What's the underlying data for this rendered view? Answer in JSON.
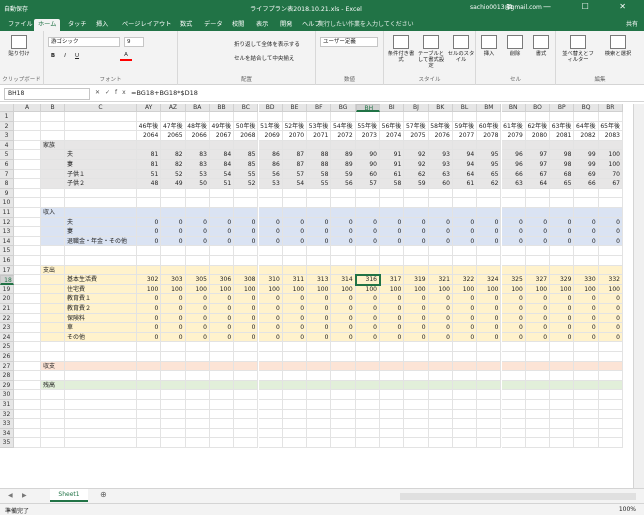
{
  "titlebar": {
    "autosave": "自動保存",
    "title": "ライフプラン表2018.10.21.xls  -  Excel",
    "user": "sachio0013@gmail.com",
    "window_controls": "⧉ — ☐ ✕"
  },
  "tabs": [
    "ファイル",
    "ホーム",
    "タッチ",
    "挿入",
    "ページレイアウト",
    "数式",
    "データ",
    "校閲",
    "表示",
    "開発",
    "ヘルプ"
  ],
  "tell_me": "実行したい作業を入力してください",
  "share": "共有",
  "ribbon": {
    "groups": {
      "clipboard": "クリップボード",
      "font": "フォント",
      "alignment": "配置",
      "number": "数値",
      "styles": "スタイル",
      "cells": "セル",
      "editing": "編集"
    },
    "paste": "貼り付け",
    "font_name": "游ゴシック",
    "font_size": "9",
    "number_format": "ユーザー定義",
    "wrap_text": "折り返して全体を表示する",
    "merge_center": "セルを結合して中央揃え",
    "cond_format": "条件付き書式",
    "table_format": "テーブルとして書式設定",
    "cell_style": "セルのスタイル",
    "insert": "挿入",
    "delete": "削除",
    "format": "書式",
    "sort_filter": "並べ替えとフィルター",
    "find_select": "検索と選択"
  },
  "formula_bar": {
    "name_box": "BH18",
    "formula": "=BG18+BG18*$D18"
  },
  "columns": [
    "A",
    "B",
    "C",
    "AY",
    "AZ",
    "BA",
    "BB",
    "BC",
    "BD",
    "BE",
    "BF",
    "BG",
    "BH",
    "BI",
    "BJ",
    "BK",
    "BL",
    "BM",
    "BN",
    "BO",
    "BP",
    "BQ",
    "BR"
  ],
  "selected_column": "BH",
  "selected_row": 18,
  "rows": [
    {
      "n": 1,
      "c": "",
      "d": []
    },
    {
      "n": 2,
      "c": "",
      "d": [
        "46年後",
        "47年後",
        "48年後",
        "49年後",
        "50年後",
        "51年後",
        "52年後",
        "53年後",
        "54年後",
        "55年後",
        "56年後",
        "57年後",
        "58年後",
        "59年後",
        "60年後",
        "61年後",
        "62年後",
        "63年後",
        "64年後",
        "65年後"
      ]
    },
    {
      "n": 3,
      "c": "",
      "d": [
        "2064",
        "2065",
        "2066",
        "2067",
        "2068",
        "2069",
        "2070",
        "2071",
        "2072",
        "2073",
        "2074",
        "2075",
        "2076",
        "2077",
        "2078",
        "2079",
        "2080",
        "2081",
        "2082",
        "2083"
      ]
    },
    {
      "n": 4,
      "b": "家族",
      "c": "",
      "d": []
    },
    {
      "n": 5,
      "c": "夫",
      "d": [
        "81",
        "82",
        "83",
        "84",
        "85",
        "86",
        "87",
        "88",
        "89",
        "90",
        "91",
        "92",
        "93",
        "94",
        "95",
        "96",
        "97",
        "98",
        "99",
        "100"
      ]
    },
    {
      "n": 6,
      "c": "妻",
      "d": [
        "81",
        "82",
        "83",
        "84",
        "85",
        "86",
        "87",
        "88",
        "89",
        "90",
        "91",
        "92",
        "93",
        "94",
        "95",
        "96",
        "97",
        "98",
        "99",
        "100"
      ]
    },
    {
      "n": 7,
      "c": "子供１",
      "d": [
        "51",
        "52",
        "53",
        "54",
        "55",
        "56",
        "57",
        "58",
        "59",
        "60",
        "61",
        "62",
        "63",
        "64",
        "65",
        "66",
        "67",
        "68",
        "69",
        "70"
      ]
    },
    {
      "n": 8,
      "c": "子供２",
      "d": [
        "48",
        "49",
        "50",
        "51",
        "52",
        "53",
        "54",
        "55",
        "56",
        "57",
        "58",
        "59",
        "60",
        "61",
        "62",
        "63",
        "64",
        "65",
        "66",
        "67"
      ]
    },
    {
      "n": 9,
      "c": "",
      "d": []
    },
    {
      "n": 10,
      "c": "",
      "d": []
    },
    {
      "n": 11,
      "b": "収入",
      "c": "",
      "d": []
    },
    {
      "n": 12,
      "c": "夫",
      "d": [
        "0",
        "0",
        "0",
        "0",
        "0",
        "0",
        "0",
        "0",
        "0",
        "0",
        "0",
        "0",
        "0",
        "0",
        "0",
        "0",
        "0",
        "0",
        "0",
        "0"
      ]
    },
    {
      "n": 13,
      "c": "妻",
      "d": [
        "0",
        "0",
        "0",
        "0",
        "0",
        "0",
        "0",
        "0",
        "0",
        "0",
        "0",
        "0",
        "0",
        "0",
        "0",
        "0",
        "0",
        "0",
        "0",
        "0"
      ]
    },
    {
      "n": 14,
      "c": "退職金・年金・その他",
      "d": [
        "0",
        "0",
        "0",
        "0",
        "0",
        "0",
        "0",
        "0",
        "0",
        "0",
        "0",
        "0",
        "0",
        "0",
        "0",
        "0",
        "0",
        "0",
        "0",
        "0"
      ]
    },
    {
      "n": 15,
      "c": "",
      "d": []
    },
    {
      "n": 16,
      "c": "",
      "d": []
    },
    {
      "n": 17,
      "b": "支出",
      "c": "",
      "d": []
    },
    {
      "n": 18,
      "c": "基本生活費",
      "d": [
        "302",
        "303",
        "305",
        "306",
        "308",
        "310",
        "311",
        "313",
        "314",
        "316",
        "317",
        "319",
        "321",
        "322",
        "324",
        "325",
        "327",
        "329",
        "330",
        "332"
      ]
    },
    {
      "n": 19,
      "c": "住宅費",
      "d": [
        "100",
        "100",
        "100",
        "100",
        "100",
        "100",
        "100",
        "100",
        "100",
        "100",
        "100",
        "100",
        "100",
        "100",
        "100",
        "100",
        "100",
        "100",
        "100",
        "100"
      ]
    },
    {
      "n": 20,
      "c": "教育費１",
      "d": [
        "0",
        "0",
        "0",
        "0",
        "0",
        "0",
        "0",
        "0",
        "0",
        "0",
        "0",
        "0",
        "0",
        "0",
        "0",
        "0",
        "0",
        "0",
        "0",
        "0"
      ]
    },
    {
      "n": 21,
      "c": "教育費２",
      "d": [
        "0",
        "0",
        "0",
        "0",
        "0",
        "0",
        "0",
        "0",
        "0",
        "0",
        "0",
        "0",
        "0",
        "0",
        "0",
        "0",
        "0",
        "0",
        "0",
        "0"
      ]
    },
    {
      "n": 22,
      "c": "保険料",
      "d": [
        "0",
        "0",
        "0",
        "0",
        "0",
        "0",
        "0",
        "0",
        "0",
        "0",
        "0",
        "0",
        "0",
        "0",
        "0",
        "0",
        "0",
        "0",
        "0",
        "0"
      ]
    },
    {
      "n": 23,
      "c": "車",
      "d": [
        "0",
        "0",
        "0",
        "0",
        "0",
        "0",
        "0",
        "0",
        "0",
        "0",
        "0",
        "0",
        "0",
        "0",
        "0",
        "0",
        "0",
        "0",
        "0",
        "0"
      ]
    },
    {
      "n": 24,
      "c": "その他",
      "d": [
        "0",
        "0",
        "0",
        "0",
        "0",
        "0",
        "0",
        "0",
        "0",
        "0",
        "0",
        "0",
        "0",
        "0",
        "0",
        "0",
        "0",
        "0",
        "0",
        "0"
      ]
    },
    {
      "n": 25,
      "c": "",
      "d": []
    },
    {
      "n": 26,
      "c": "",
      "d": []
    },
    {
      "n": 27,
      "b": "収支",
      "c": "",
      "d": []
    },
    {
      "n": 28,
      "c": "",
      "d": []
    },
    {
      "n": 29,
      "b": "残高",
      "c": "",
      "d": []
    },
    {
      "n": 30,
      "c": "",
      "d": []
    },
    {
      "n": 31,
      "c": "",
      "d": []
    },
    {
      "n": 32,
      "c": "",
      "d": []
    },
    {
      "n": 33,
      "c": "",
      "d": []
    },
    {
      "n": 34,
      "c": "",
      "d": []
    },
    {
      "n": 35,
      "c": "",
      "d": []
    }
  ],
  "sheet_tab": "Sheet1",
  "status": {
    "ready": "準備完了",
    "zoom": "100%"
  },
  "colors": {
    "accent": "#217346",
    "band_family": "#e7e6e6",
    "band_income": "#dae3f3",
    "band_expense": "#fff2cc",
    "band_balance": "#fce4d6",
    "band_remain": "#e2efda"
  }
}
